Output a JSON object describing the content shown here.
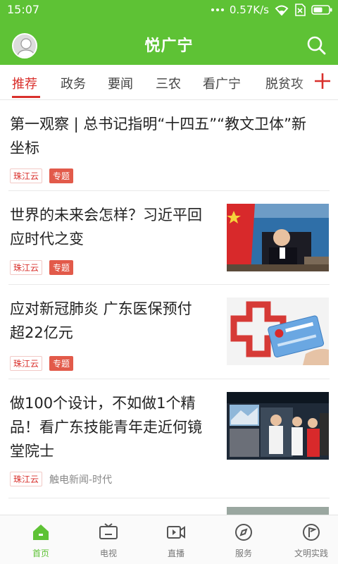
{
  "status_bar": {
    "time": "15:07",
    "network_speed": "0.57K/s"
  },
  "app_bar": {
    "title": "悦广宁"
  },
  "tabs": [
    {
      "label": "推荐",
      "active": true
    },
    {
      "label": "政务"
    },
    {
      "label": "要闻"
    },
    {
      "label": "三农"
    },
    {
      "label": "看广宁"
    },
    {
      "label": "脱贫攻"
    }
  ],
  "feed": [
    {
      "title_lines": [
        "第一观察 | 总书记指明“十四五”“教文卫体”新",
        "坐标"
      ],
      "source_tag": "珠江云",
      "topic_tag": "专题"
    },
    {
      "title_lines": [
        "世界的未来会怎样？习近平回",
        "应时代之变"
      ],
      "source_tag": "珠江云",
      "topic_tag": "专题",
      "thumbnail": "flag-speech-image"
    },
    {
      "title_lines": [
        "应对新冠肺炎 广东医保预付",
        "超22亿元"
      ],
      "source_tag": "珠江云",
      "topic_tag": "专题",
      "thumbnail": "medical-insurance-card-image"
    },
    {
      "title_lines": [
        "做100个设计，不如做1个精",
        "品！看广东技能青年走近何镜",
        "堂院士"
      ],
      "source_tag": "珠江云",
      "meta_text": "触电新闻-时代",
      "thumbnail": "exhibition-visit-image"
    }
  ],
  "bottom_nav": [
    {
      "label": "首页",
      "icon": "home-icon",
      "active": true
    },
    {
      "label": "电视",
      "icon": "tv-icon"
    },
    {
      "label": "直播",
      "icon": "live-video-icon"
    },
    {
      "label": "服务",
      "icon": "compass-icon"
    },
    {
      "label": "文明实践",
      "icon": "flag-badge-icon"
    }
  ],
  "colors": {
    "brand_green": "#5ec235",
    "accent_red": "#d9302c"
  }
}
